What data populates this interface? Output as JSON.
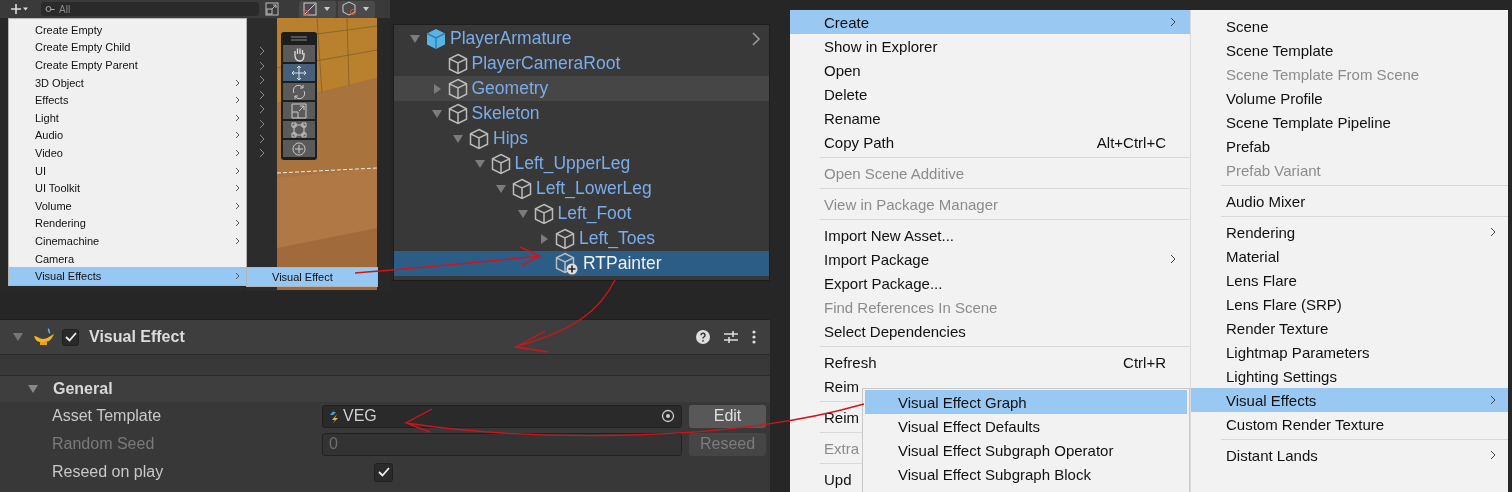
{
  "hierarchy_toolbar": {
    "search": {
      "placeholder": "All"
    }
  },
  "gameobject_menu": {
    "items": [
      {
        "label": "Create Empty",
        "submenu": false,
        "selected": false
      },
      {
        "label": "Create Empty Child",
        "submenu": false,
        "selected": false
      },
      {
        "label": "Create Empty Parent",
        "submenu": false,
        "selected": false
      },
      {
        "label": "3D Object",
        "submenu": true,
        "selected": false
      },
      {
        "label": "Effects",
        "submenu": true,
        "selected": false
      },
      {
        "label": "Light",
        "submenu": true,
        "selected": false
      },
      {
        "label": "Audio",
        "submenu": true,
        "selected": false
      },
      {
        "label": "Video",
        "submenu": true,
        "selected": false
      },
      {
        "label": "UI",
        "submenu": true,
        "selected": false
      },
      {
        "label": "UI Toolkit",
        "submenu": true,
        "selected": false
      },
      {
        "label": "Volume",
        "submenu": true,
        "selected": false
      },
      {
        "label": "Rendering",
        "submenu": true,
        "selected": false
      },
      {
        "label": "Cinemachine",
        "submenu": true,
        "selected": false
      },
      {
        "label": "Camera",
        "submenu": false,
        "selected": false
      },
      {
        "label": "Visual Effects",
        "submenu": true,
        "selected": true
      }
    ],
    "submenu": {
      "items": [
        {
          "label": "Visual Effect",
          "selected": true
        }
      ]
    }
  },
  "scene_tools": [
    {
      "kind": "hand",
      "selected": false
    },
    {
      "kind": "move",
      "selected": true
    },
    {
      "kind": "rotate",
      "selected": false
    },
    {
      "kind": "scale",
      "selected": false
    },
    {
      "kind": "rect",
      "selected": false
    },
    {
      "kind": "transform",
      "selected": false
    }
  ],
  "hierarchy": {
    "items": [
      {
        "label": "PlayerArmature",
        "kind": "prefab",
        "expanded": true,
        "selected": false,
        "hovered": false,
        "children": [
          {
            "label": "PlayerCameraRoot",
            "kind": "object",
            "selected": false,
            "hovered": false
          },
          {
            "label": "Geometry",
            "kind": "object",
            "expanded": false,
            "selected": false,
            "hovered": true
          },
          {
            "label": "Skeleton",
            "kind": "object",
            "expanded": true,
            "selected": false,
            "hovered": false,
            "children": [
              {
                "label": "Hips",
                "kind": "object",
                "expanded": true,
                "selected": false,
                "hovered": false,
                "children": [
                  {
                    "label": "Left_UpperLeg",
                    "kind": "object",
                    "expanded": true,
                    "selected": false,
                    "hovered": false,
                    "children": [
                      {
                        "label": "Left_LowerLeg",
                        "kind": "object",
                        "expanded": true,
                        "selected": false,
                        "hovered": false,
                        "children": [
                          {
                            "label": "Left_Foot",
                            "kind": "object",
                            "expanded": true,
                            "selected": false,
                            "hovered": false,
                            "children": [
                              {
                                "label": "Left_Toes",
                                "kind": "object",
                                "expanded": false,
                                "selected": false,
                                "hovered": false
                              },
                              {
                                "label": "RTPainter",
                                "kind": "added",
                                "selected": true,
                                "hovered": false
                              }
                            ]
                          }
                        ]
                      }
                    ]
                  }
                ]
              }
            ]
          }
        ]
      }
    ]
  },
  "inspector": {
    "component": {
      "title": "Visual Effect",
      "enabled": true,
      "expanded": true
    },
    "section": {
      "title": "General",
      "expanded": true
    },
    "fields": [
      {
        "kind": "object",
        "label": "Asset Template",
        "value": "VEG",
        "button": "Edit",
        "disabled": false
      },
      {
        "kind": "number",
        "label": "Random Seed",
        "value": "0",
        "button": "Reseed",
        "disabled": true
      },
      {
        "kind": "toggle",
        "label": "Reseed on play",
        "checked": true,
        "disabled": false
      }
    ]
  },
  "project_menu": {
    "items": [
      {
        "label": "Create",
        "submenu": true,
        "disabled": false,
        "selected": true,
        "separator_before": false
      },
      {
        "label": "Show in Explorer",
        "submenu": false,
        "disabled": false,
        "selected": false,
        "separator_before": false
      },
      {
        "label": "Open",
        "submenu": false,
        "disabled": false,
        "selected": false,
        "separator_before": false
      },
      {
        "label": "Delete",
        "submenu": false,
        "disabled": false,
        "selected": false,
        "separator_before": false
      },
      {
        "label": "Rename",
        "submenu": false,
        "disabled": false,
        "selected": false,
        "separator_before": false
      },
      {
        "label": "Copy Path",
        "shortcut": "Alt+Ctrl+C",
        "submenu": false,
        "disabled": false,
        "selected": false,
        "separator_before": false
      },
      {
        "label": "Open Scene Additive",
        "submenu": false,
        "disabled": true,
        "selected": false,
        "separator_before": true
      },
      {
        "label": "View in Package Manager",
        "submenu": false,
        "disabled": true,
        "selected": false,
        "separator_before": true
      },
      {
        "label": "Import New Asset...",
        "submenu": false,
        "disabled": false,
        "selected": false,
        "separator_before": true
      },
      {
        "label": "Import Package",
        "submenu": true,
        "disabled": false,
        "selected": false,
        "separator_before": false
      },
      {
        "label": "Export Package...",
        "submenu": false,
        "disabled": false,
        "selected": false,
        "separator_before": false
      },
      {
        "label": "Find References In Scene",
        "submenu": false,
        "disabled": true,
        "selected": false,
        "separator_before": false
      },
      {
        "label": "Select Dependencies",
        "submenu": false,
        "disabled": false,
        "selected": false,
        "separator_before": false
      },
      {
        "label": "Refresh",
        "shortcut": "Ctrl+R",
        "submenu": false,
        "disabled": false,
        "selected": false,
        "separator_before": true
      },
      {
        "label": "Reim",
        "disabled": false,
        "selected": false,
        "separator_before": false
      },
      {
        "label": "Reim",
        "disabled": false,
        "selected": false,
        "separator_before": true
      },
      {
        "label": "Extra",
        "disabled": true,
        "selected": false,
        "separator_before": true
      },
      {
        "label": "Upd",
        "disabled": false,
        "selected": false,
        "separator_before": true
      }
    ]
  },
  "create_menu": {
    "items": [
      {
        "label": "Scene",
        "submenu": false,
        "disabled": false,
        "selected": false,
        "separator_before": false
      },
      {
        "label": "Scene Template",
        "submenu": false,
        "disabled": false,
        "selected": false,
        "separator_before": false
      },
      {
        "label": "Scene Template From Scene",
        "submenu": false,
        "disabled": true,
        "selected": false,
        "separator_before": false
      },
      {
        "label": "Volume Profile",
        "submenu": false,
        "disabled": false,
        "selected": false,
        "separator_before": false
      },
      {
        "label": "Scene Template Pipeline",
        "submenu": false,
        "disabled": false,
        "selected": false,
        "separator_before": false
      },
      {
        "label": "Prefab",
        "submenu": false,
        "disabled": false,
        "selected": false,
        "separator_before": false
      },
      {
        "label": "Prefab Variant",
        "submenu": false,
        "disabled": true,
        "selected": false,
        "separator_before": false
      },
      {
        "label": "Audio Mixer",
        "submenu": false,
        "disabled": false,
        "selected": false,
        "separator_before": true
      },
      {
        "label": "Rendering",
        "submenu": true,
        "disabled": false,
        "selected": false,
        "separator_before": true
      },
      {
        "label": "Material",
        "submenu": false,
        "disabled": false,
        "selected": false,
        "separator_before": false
      },
      {
        "label": "Lens Flare",
        "submenu": false,
        "disabled": false,
        "selected": false,
        "separator_before": false
      },
      {
        "label": "Lens Flare (SRP)",
        "submenu": false,
        "disabled": false,
        "selected": false,
        "separator_before": false
      },
      {
        "label": "Render Texture",
        "submenu": false,
        "disabled": false,
        "selected": false,
        "separator_before": false
      },
      {
        "label": "Lightmap Parameters",
        "submenu": false,
        "disabled": false,
        "selected": false,
        "separator_before": false
      },
      {
        "label": "Lighting Settings",
        "submenu": false,
        "disabled": false,
        "selected": false,
        "separator_before": false
      },
      {
        "label": "Visual Effects",
        "submenu": true,
        "disabled": false,
        "selected": true,
        "separator_before": false
      },
      {
        "label": "Custom Render Texture",
        "submenu": false,
        "disabled": false,
        "selected": false,
        "separator_before": false
      },
      {
        "label": "Distant Lands",
        "submenu": true,
        "disabled": false,
        "selected": false,
        "separator_before": true
      }
    ]
  },
  "visual_effects_menu": {
    "items": [
      {
        "label": "Visual Effect Graph",
        "selected": true
      },
      {
        "label": "Visual Effect Defaults",
        "selected": false
      },
      {
        "label": "Visual Effect Subgraph Operator",
        "selected": false
      },
      {
        "label": "Visual Effect Subgraph Block",
        "selected": false
      }
    ]
  }
}
